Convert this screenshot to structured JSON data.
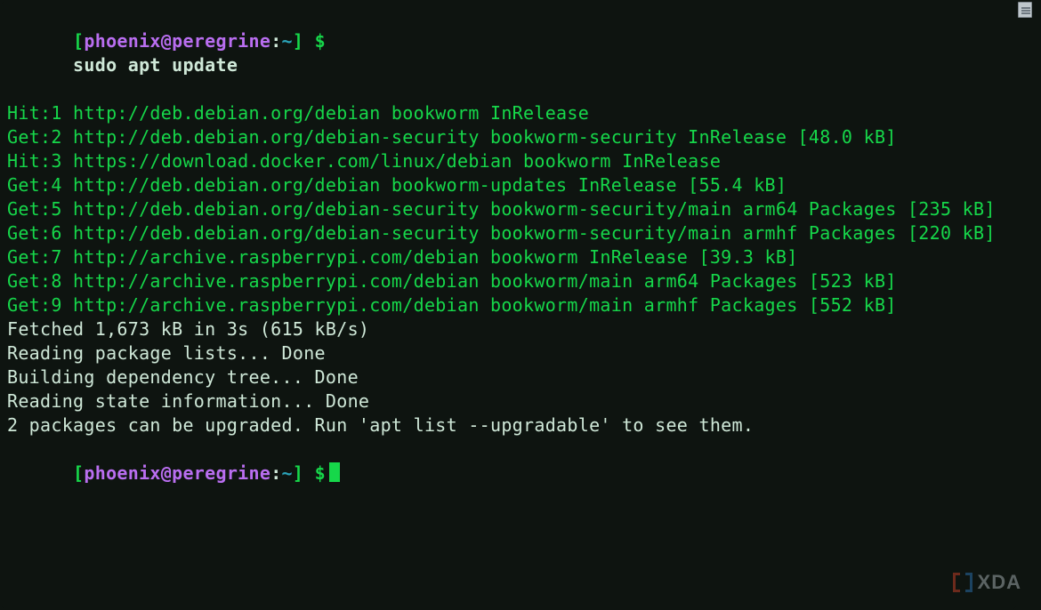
{
  "prompt": {
    "open_bracket": "[",
    "user": "phoenix",
    "at": "@",
    "host": "peregrine",
    "colon": ":",
    "cwd": "~",
    "close_bracket_dollar": " $",
    "command": "sudo apt update"
  },
  "output": {
    "green_lines": [
      "Hit:1 http://deb.debian.org/debian bookworm InRelease",
      "Get:2 http://deb.debian.org/debian-security bookworm-security InRelease [48.0 kB]",
      "Hit:3 https://download.docker.com/linux/debian bookworm InRelease",
      "Get:4 http://deb.debian.org/debian bookworm-updates InRelease [55.4 kB]",
      "Get:5 http://deb.debian.org/debian-security bookworm-security/main arm64 Packages [235 kB]",
      "Get:6 http://deb.debian.org/debian-security bookworm-security/main armhf Packages [220 kB]",
      "Get:7 http://archive.raspberrypi.com/debian bookworm InRelease [39.3 kB]",
      "Get:8 http://archive.raspberrypi.com/debian bookworm/main arm64 Packages [523 kB]",
      "Get:9 http://archive.raspberrypi.com/debian bookworm/main armhf Packages [552 kB]"
    ],
    "plain_lines": [
      "Fetched 1,673 kB in 3s (615 kB/s)",
      "Reading package lists... Done",
      "Building dependency tree... Done",
      "Reading state information... Done",
      "2 packages can be upgraded. Run 'apt list --upgradable' to see them."
    ]
  },
  "prompt2": {
    "open_bracket": "[",
    "user": "phoenix",
    "at": "@",
    "host": "peregrine",
    "colon": ":",
    "cwd": "~",
    "close_bracket_dollar": " $"
  },
  "watermark": {
    "text": "XDA"
  }
}
